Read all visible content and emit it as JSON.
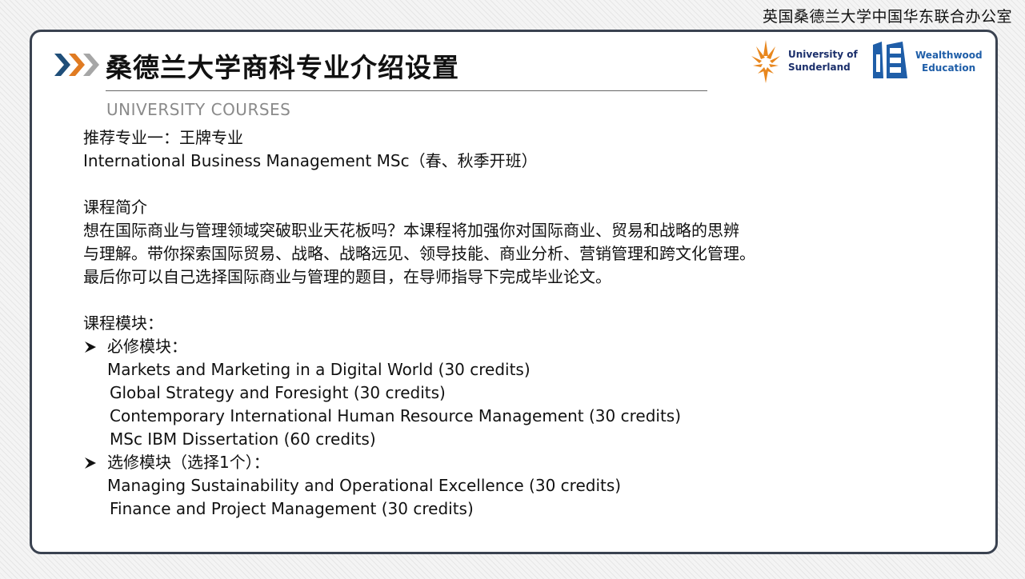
{
  "header": {
    "office_label": "英国桑德兰大学中国华东联合办公室"
  },
  "slide": {
    "title": "桑德兰大学商科专业介绍设置",
    "subtitle": "UNIVERSITY COURSES"
  },
  "logos": {
    "sunderland": {
      "line1": "University of",
      "line2": "Sunderland"
    },
    "wealthwood": {
      "line1": "Wealthwood",
      "line2": "Education"
    }
  },
  "content": {
    "recommend_heading": "推荐专业一：王牌专业",
    "program_name": "International Business Management MSc（春、秋季开班）",
    "intro_heading": "课程简介",
    "intro_lines": [
      "想在国际商业与管理领域突破职业天花板吗？本课程将加强你对国际商业、贸易和战略的思辨",
      "与理解。带你探索国际贸易、战略、战略远见、领导技能、商业分析、营销管理和跨文化管理。",
      "最后你可以自己选择国际商业与管理的题目，在导师指导下完成毕业论文。"
    ],
    "modules_heading": "课程模块：",
    "required_label": "必修模块：",
    "required_modules": [
      "Markets and Marketing in a Digital World (30 credits)",
      "Global Strategy and Foresight (30 credits)",
      "Contemporary International Human Resource Management (30 credits)",
      "MSc IBM Dissertation (60 credits)"
    ],
    "elective_label": "选修模块（选择1个）：",
    "elective_modules": [
      "Managing Sustainability and Operational Excellence (30 credits)",
      "Finance and Project Management (30 credits)"
    ]
  },
  "colors": {
    "frame_border": "#3a4250",
    "chevron_blue": "#1f4e79",
    "chevron_orange": "#e07b22",
    "chevron_gray": "#a6a6a6",
    "sunderland_orange": "#e8871e",
    "sunderland_navy": "#1b2f6b",
    "wealthwood_blue": "#1f5ea8",
    "subtitle_gray": "#8a8a8a"
  }
}
